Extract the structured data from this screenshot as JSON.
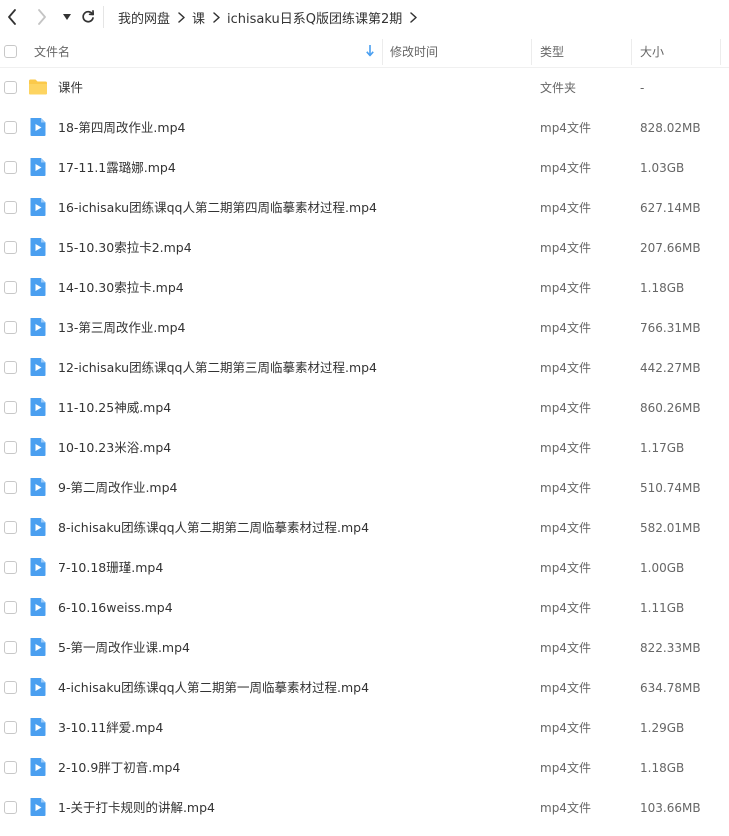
{
  "breadcrumb": [
    "我的网盘",
    "课",
    "ichisaku日系Q版团练课第2期"
  ],
  "columns": {
    "name": "文件名",
    "modified": "修改时间",
    "type": "类型",
    "size": "大小"
  },
  "files": [
    {
      "name": "课件",
      "type": "文件夹",
      "size": "-",
      "icon": "folder-icon"
    },
    {
      "name": "18-第四周改作业.mp4",
      "type": "mp4文件",
      "size": "828.02MB",
      "icon": "video-file-icon"
    },
    {
      "name": "17-11.1露璐娜.mp4",
      "type": "mp4文件",
      "size": "1.03GB",
      "icon": "video-file-icon"
    },
    {
      "name": "16-ichisaku团练课qq人第二期第四周临摹素材过程.mp4",
      "type": "mp4文件",
      "size": "627.14MB",
      "icon": "video-file-icon"
    },
    {
      "name": "15-10.30索拉卡2.mp4",
      "type": "mp4文件",
      "size": "207.66MB",
      "icon": "video-file-icon"
    },
    {
      "name": "14-10.30索拉卡.mp4",
      "type": "mp4文件",
      "size": "1.18GB",
      "icon": "video-file-icon"
    },
    {
      "name": "13-第三周改作业.mp4",
      "type": "mp4文件",
      "size": "766.31MB",
      "icon": "video-file-icon"
    },
    {
      "name": "12-ichisaku团练课qq人第二期第三周临摹素材过程.mp4",
      "type": "mp4文件",
      "size": "442.27MB",
      "icon": "video-file-icon"
    },
    {
      "name": "11-10.25神威.mp4",
      "type": "mp4文件",
      "size": "860.26MB",
      "icon": "video-file-icon"
    },
    {
      "name": "10-10.23米浴.mp4",
      "type": "mp4文件",
      "size": "1.17GB",
      "icon": "video-file-icon"
    },
    {
      "name": "9-第二周改作业.mp4",
      "type": "mp4文件",
      "size": "510.74MB",
      "icon": "video-file-icon"
    },
    {
      "name": "8-ichisaku团练课qq人第二期第二周临摹素材过程.mp4",
      "type": "mp4文件",
      "size": "582.01MB",
      "icon": "video-file-icon"
    },
    {
      "name": "7-10.18珊瑾.mp4",
      "type": "mp4文件",
      "size": "1.00GB",
      "icon": "video-file-icon"
    },
    {
      "name": "6-10.16weiss.mp4",
      "type": "mp4文件",
      "size": "1.11GB",
      "icon": "video-file-icon"
    },
    {
      "name": "5-第一周改作业课.mp4",
      "type": "mp4文件",
      "size": "822.33MB",
      "icon": "video-file-icon"
    },
    {
      "name": "4-ichisaku团练课qq人第二期第一周临摹素材过程.mp4",
      "type": "mp4文件",
      "size": "634.78MB",
      "icon": "video-file-icon"
    },
    {
      "name": "3-10.11絆爱.mp4",
      "type": "mp4文件",
      "size": "1.29GB",
      "icon": "video-file-icon"
    },
    {
      "name": "2-10.9胖丁初音.mp4",
      "type": "mp4文件",
      "size": "1.18GB",
      "icon": "video-file-icon"
    },
    {
      "name": "1-关于打卡规则的讲解.mp4",
      "type": "mp4文件",
      "size": "103.66MB",
      "icon": "video-file-icon"
    }
  ],
  "colors": {
    "accent": "#4a9ff0",
    "folder": "#fbc94a"
  }
}
